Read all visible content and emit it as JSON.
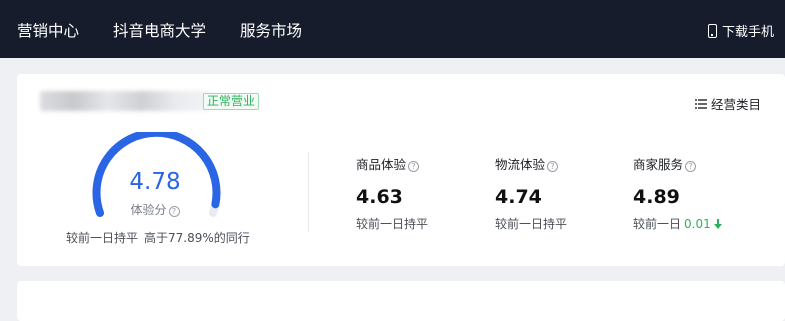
{
  "topnav": {
    "items": [
      "营销中心",
      "抖音电商大学",
      "服务市场"
    ],
    "download_label": "下载手机"
  },
  "shop": {
    "status_badge": "正常营业",
    "category_label": "经营类目"
  },
  "experience_score": {
    "value": "4.78",
    "label": "体验分",
    "gauge_fill_fraction": 0.96,
    "trend_text": "较前一日持平",
    "percentile_text": "高于77.89%的同行"
  },
  "metrics": [
    {
      "label": "商品体验",
      "value": "4.63",
      "compare": "较前一日持平",
      "delta": ""
    },
    {
      "label": "物流体验",
      "value": "4.74",
      "compare": "较前一日持平",
      "delta": ""
    },
    {
      "label": "商家服务",
      "value": "4.89",
      "compare": "较前一日",
      "delta": "0.01"
    }
  ],
  "colors": {
    "topbar_bg": "#161c2c",
    "accent_blue": "#2a65e6",
    "positive_green": "#2bb35b"
  },
  "icons": {
    "phone": "phone-icon",
    "list": "list-icon",
    "help": "question-circle-icon",
    "down": "arrow-down-icon"
  }
}
